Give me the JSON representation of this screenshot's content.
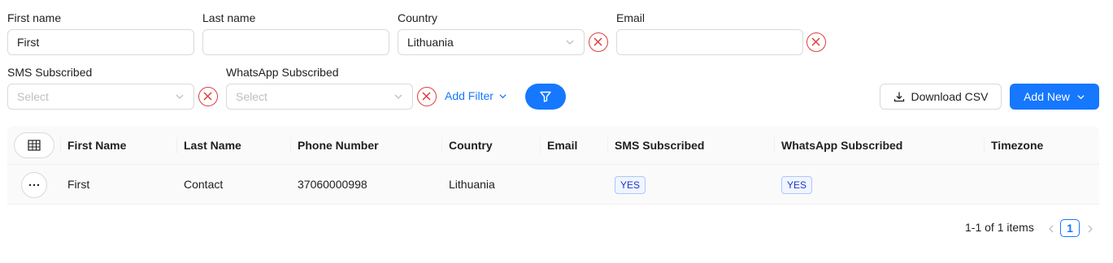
{
  "filters": {
    "first_name": {
      "label": "First name",
      "value": "First"
    },
    "last_name": {
      "label": "Last name",
      "value": ""
    },
    "country": {
      "label": "Country",
      "value": "Lithuania"
    },
    "email": {
      "label": "Email",
      "value": ""
    },
    "sms_subscribed": {
      "label": "SMS Subscribed",
      "placeholder": "Select"
    },
    "whatsapp_subscribed": {
      "label": "WhatsApp Subscribed",
      "placeholder": "Select"
    },
    "add_filter_label": "Add Filter"
  },
  "actions": {
    "download_csv_label": "Download CSV",
    "add_new_label": "Add New"
  },
  "table": {
    "columns": [
      "First Name",
      "Last Name",
      "Phone Number",
      "Country",
      "Email",
      "SMS Subscribed",
      "WhatsApp Subscribed",
      "Timezone"
    ],
    "rows": [
      {
        "first_name": "First",
        "last_name": "Contact",
        "phone": "37060000998",
        "country": "Lithuania",
        "email": "",
        "sms": "YES",
        "whatsapp": "YES",
        "timezone": ""
      }
    ]
  },
  "pagination": {
    "summary": "1-1 of 1 items",
    "current_page": "1"
  },
  "colors": {
    "primary": "#1677ff",
    "danger": "#e03b3b",
    "tag_text": "#1d39c4"
  }
}
